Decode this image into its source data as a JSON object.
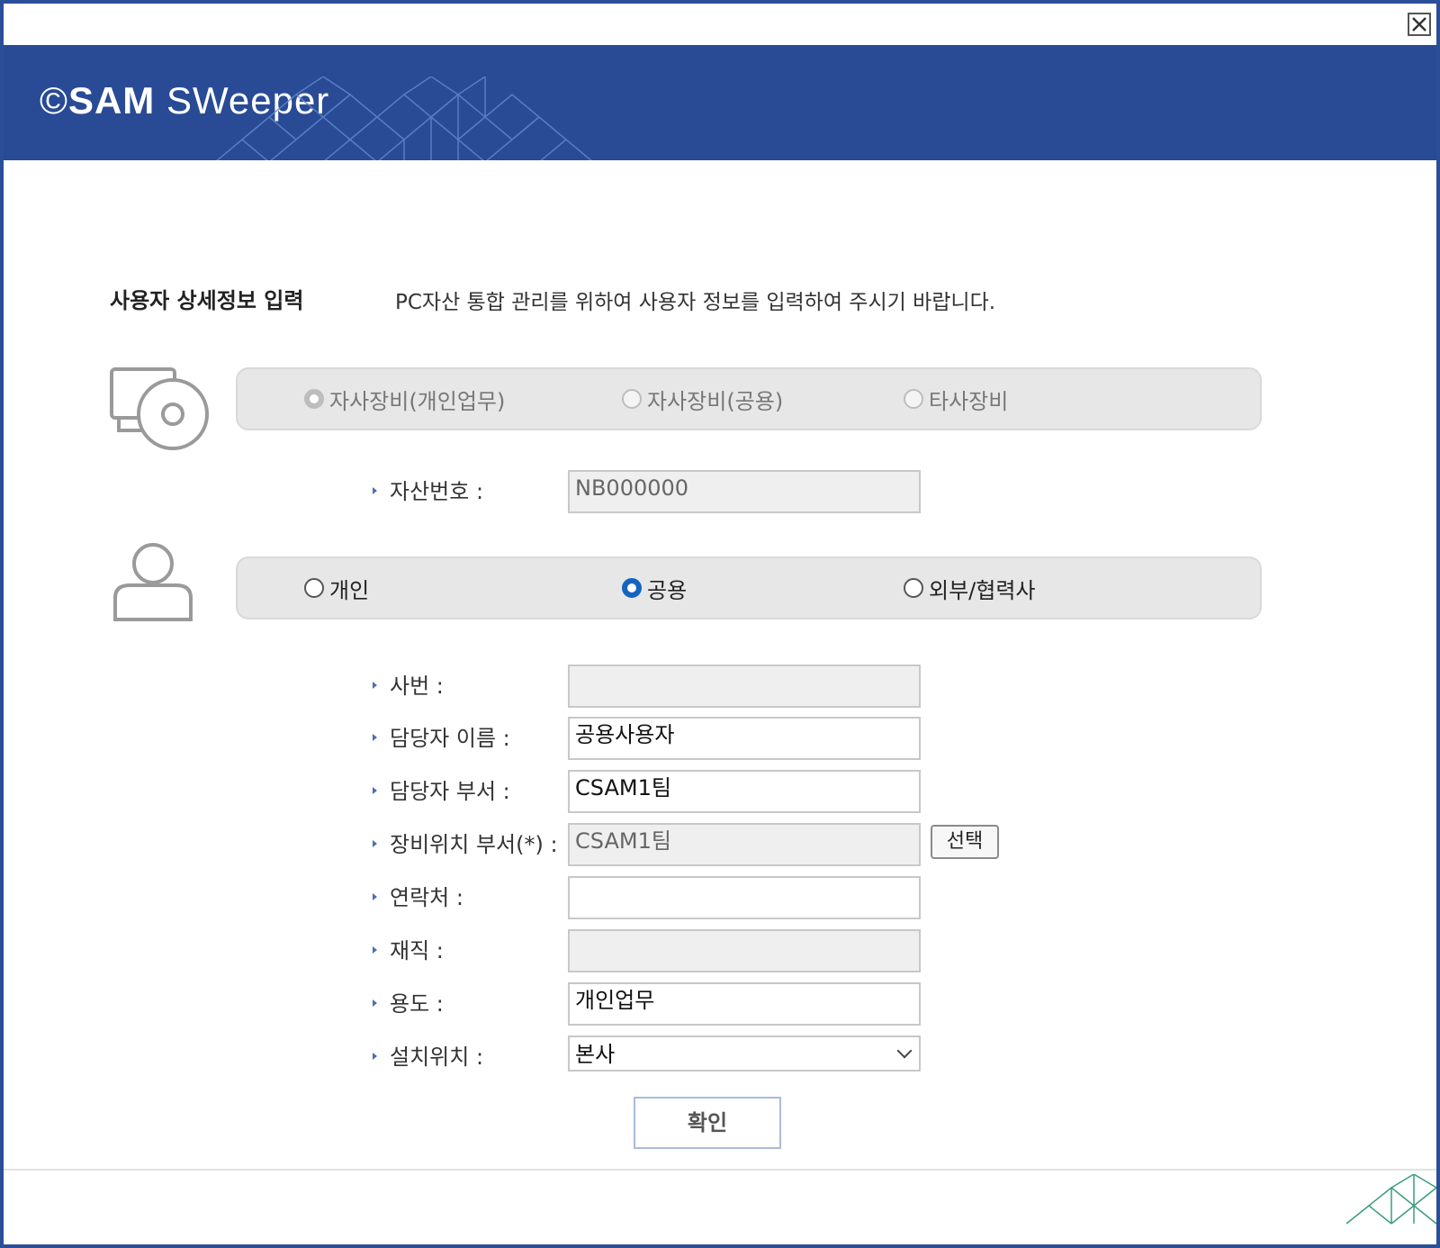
{
  "window": {
    "close_icon": "close-icon"
  },
  "banner": {
    "logo_prefix": "©",
    "logo_bold": "SAM",
    "logo_light": " SWeeper",
    "background_color": "#294b96"
  },
  "header": {
    "title": "사용자 상세정보 입력",
    "description": "PC자산 통합 관리를 위하여 사용자 정보를 입력하여 주시기 바랍니다."
  },
  "equipment_type": {
    "icon": "monitor-disc-icon",
    "options": [
      {
        "label": "자사장비(개인업무)",
        "checked": true,
        "disabled": true
      },
      {
        "label": "자사장비(공용)",
        "checked": false,
        "disabled": true
      },
      {
        "label": "타사장비",
        "checked": false,
        "disabled": true
      }
    ]
  },
  "asset": {
    "label": "자산번호 :",
    "value": "NB000000"
  },
  "user_type": {
    "icon": "user-icon",
    "options": [
      {
        "label": "개인",
        "checked": false
      },
      {
        "label": "공용",
        "checked": true
      },
      {
        "label": "외부/협력사",
        "checked": false
      }
    ],
    "accent_color": "#1565c0"
  },
  "fields": {
    "employee_no": {
      "label": "사번 :",
      "value": ""
    },
    "manager_name": {
      "label": "담당자 이름 :",
      "value": "공용사용자"
    },
    "manager_dept": {
      "label": "담당자 부서 :",
      "value": "CSAM1팀"
    },
    "location_dept": {
      "label": "장비위치 부서(*) :",
      "value": "CSAM1팀",
      "button": "선택"
    },
    "contact": {
      "label": "연락처 :",
      "value": ""
    },
    "employment": {
      "label": "재직 :",
      "value": ""
    },
    "usage": {
      "label": "용도 :",
      "value": "개인업무"
    },
    "install_location": {
      "label": "설치위치 :",
      "value": "본사"
    }
  },
  "actions": {
    "confirm": "확인"
  }
}
